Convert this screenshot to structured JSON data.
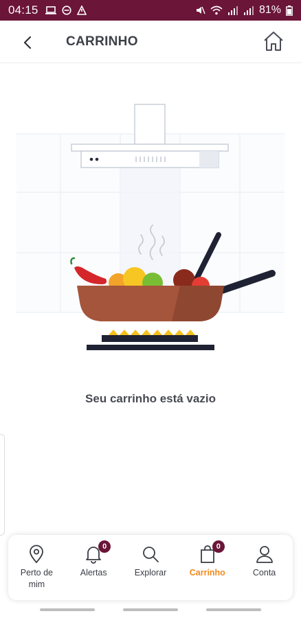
{
  "status_bar": {
    "time": "04:15",
    "battery": "81%"
  },
  "header": {
    "title": "CARRINHO",
    "back_icon": "chevron-left-icon",
    "home_icon": "home-icon"
  },
  "main": {
    "empty_message": "Seu carrinho está vazio",
    "illustration": "kitchen-pan-illustration"
  },
  "bottom_nav": {
    "items": [
      {
        "label": "Perto de mim",
        "icon": "location-pin-icon",
        "active": false
      },
      {
        "label": "Alertas",
        "icon": "bell-icon",
        "badge": "0",
        "active": false
      },
      {
        "label": "Explorar",
        "icon": "search-icon",
        "active": false
      },
      {
        "label": "Carrinho",
        "icon": "shopping-bag-icon",
        "badge": "0",
        "active": true
      },
      {
        "label": "Conta",
        "icon": "user-icon",
        "active": false
      }
    ]
  },
  "colors": {
    "brand": "#6b1538",
    "accent": "#f08a1c",
    "text": "#3d4048"
  }
}
